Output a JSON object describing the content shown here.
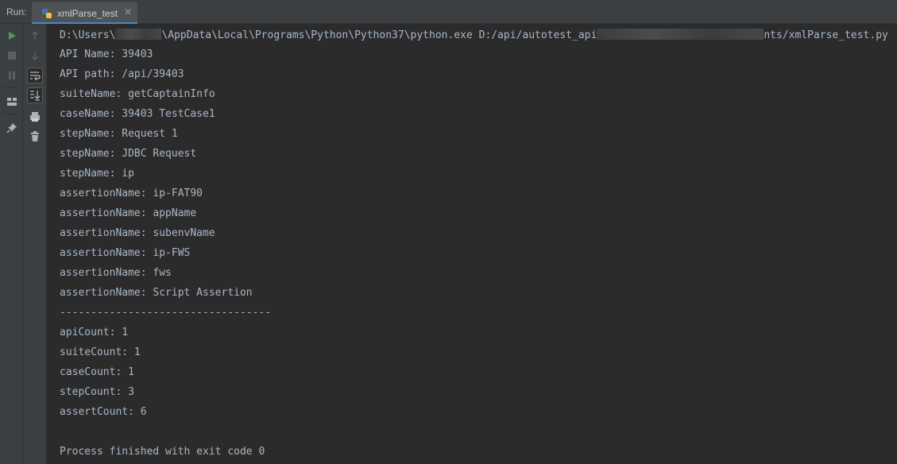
{
  "run_panel": {
    "label": "Run:",
    "tab": {
      "title": "xmlParse_test",
      "close": "✕"
    }
  },
  "toolbar": {
    "left": [
      "run-icon",
      "stop-icon",
      "pause-icon",
      "layout-icon",
      "pin-icon"
    ],
    "right": [
      "up-arrow-icon",
      "down-arrow-icon",
      "soft-wrap-icon",
      "scroll-to-end-icon",
      "print-icon",
      "trash-icon"
    ]
  },
  "console": {
    "cmd": {
      "part1": "D:\\Users\\",
      "part2": "\\AppData\\Local\\Programs\\Python\\Python37\\python.exe D:/api/autotest_api",
      "part3": "nts/xmlParse_test.py"
    },
    "lines": [
      "API Name: 39403",
      "API path: /api/39403",
      "suiteName: getCaptainInfo",
      "caseName: 39403 TestCase1",
      "stepName: Request 1",
      "stepName: JDBC Request",
      "stepName: ip",
      "assertionName: ip-FAT90",
      "assertionName: appName",
      "assertionName: subenvName",
      "assertionName: ip-FWS",
      "assertionName: fws",
      "assertionName: Script Assertion",
      "----------------------------------",
      "apiCount: 1",
      "suiteCount: 1",
      "caseCount: 1",
      "stepCount: 3",
      "assertCount: 6",
      "",
      "Process finished with exit code 0"
    ]
  },
  "colors": {
    "background": "#2b2b2b",
    "panel": "#3c3f41",
    "console_text": "#a9b7c6",
    "run_green": "#499c54",
    "tab_accent": "#4a88c7"
  }
}
